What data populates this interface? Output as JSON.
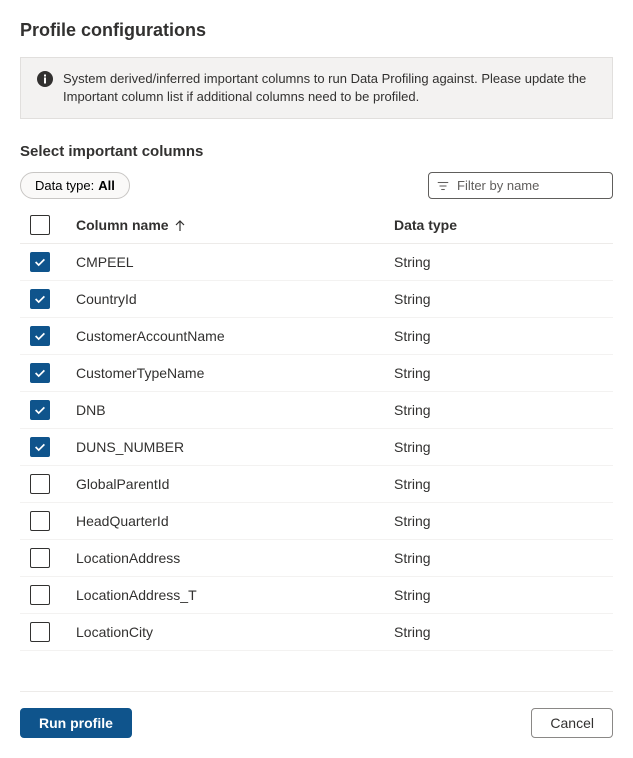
{
  "header": {
    "title": "Profile configurations"
  },
  "info": {
    "message": "System derived/inferred important columns to run Data Profiling against. Please update the Important column list if additional columns need to be profiled."
  },
  "section": {
    "title": "Select important columns"
  },
  "filter": {
    "pill_label": "Data type:",
    "pill_value": "All",
    "search_placeholder": "Filter by name"
  },
  "table": {
    "headers": {
      "name": "Column name",
      "type": "Data type"
    },
    "rows": [
      {
        "checked": true,
        "name": "CMPEEL",
        "type": "String"
      },
      {
        "checked": true,
        "name": "CountryId",
        "type": "String"
      },
      {
        "checked": true,
        "name": "CustomerAccountName",
        "type": "String"
      },
      {
        "checked": true,
        "name": "CustomerTypeName",
        "type": "String"
      },
      {
        "checked": true,
        "name": "DNB",
        "type": "String"
      },
      {
        "checked": true,
        "name": "DUNS_NUMBER",
        "type": "String"
      },
      {
        "checked": false,
        "name": "GlobalParentId",
        "type": "String"
      },
      {
        "checked": false,
        "name": "HeadQuarterId",
        "type": "String"
      },
      {
        "checked": false,
        "name": "LocationAddress",
        "type": "String"
      },
      {
        "checked": false,
        "name": "LocationAddress_T",
        "type": "String"
      },
      {
        "checked": false,
        "name": "LocationCity",
        "type": "String"
      }
    ]
  },
  "footer": {
    "primary_label": "Run profile",
    "secondary_label": "Cancel"
  }
}
